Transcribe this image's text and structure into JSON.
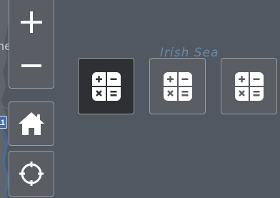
{
  "map": {
    "sea_label": "Irish Sea",
    "coast_label": "he",
    "road_badge": "11"
  },
  "controls": {
    "zoom_in_icon": "plus-icon",
    "zoom_out_icon": "minus-icon",
    "home_icon": "home-icon",
    "locate_icon": "crosshair-icon"
  },
  "tools": [
    {
      "icon": "calculator-icon",
      "active": true
    },
    {
      "icon": "calculator-icon",
      "active": false
    },
    {
      "icon": "calculator-icon",
      "active": false
    }
  ],
  "colors": {
    "map_background": "#525862",
    "button_background": "#5a5d63",
    "button_active_background": "#2f3033",
    "button_border": "#9a9da2",
    "icon": "#ffffff",
    "sea_label": "#6e8fb0"
  }
}
